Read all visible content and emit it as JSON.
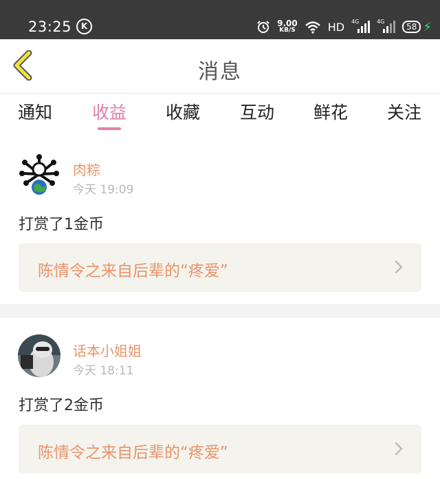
{
  "status_bar": {
    "time": "23:25",
    "k_icon": "K",
    "speed_value": "9.00",
    "speed_unit": "KB/S",
    "hd": "HD",
    "net1": "4G",
    "net2": "4G",
    "battery": "58"
  },
  "header": {
    "title": "消息"
  },
  "tabs": [
    {
      "label": "通知"
    },
    {
      "label": "收益"
    },
    {
      "label": "收藏"
    },
    {
      "label": "互动"
    },
    {
      "label": "鲜花"
    },
    {
      "label": "关注"
    }
  ],
  "active_tab": 1,
  "colors": {
    "accent": "#e07fa8",
    "name": "#e8946a",
    "status_bar": "#3a3a3a"
  },
  "messages": [
    {
      "user": "肉粽",
      "time": "今天 19:09",
      "action": "打赏了1金币",
      "source": "陈情令之来自后辈的“疼爱”"
    },
    {
      "user": "话本小姐姐",
      "time": "今天 18:11",
      "action": "打赏了2金币",
      "source": "陈情令之来自后辈的“疼爱”"
    }
  ]
}
